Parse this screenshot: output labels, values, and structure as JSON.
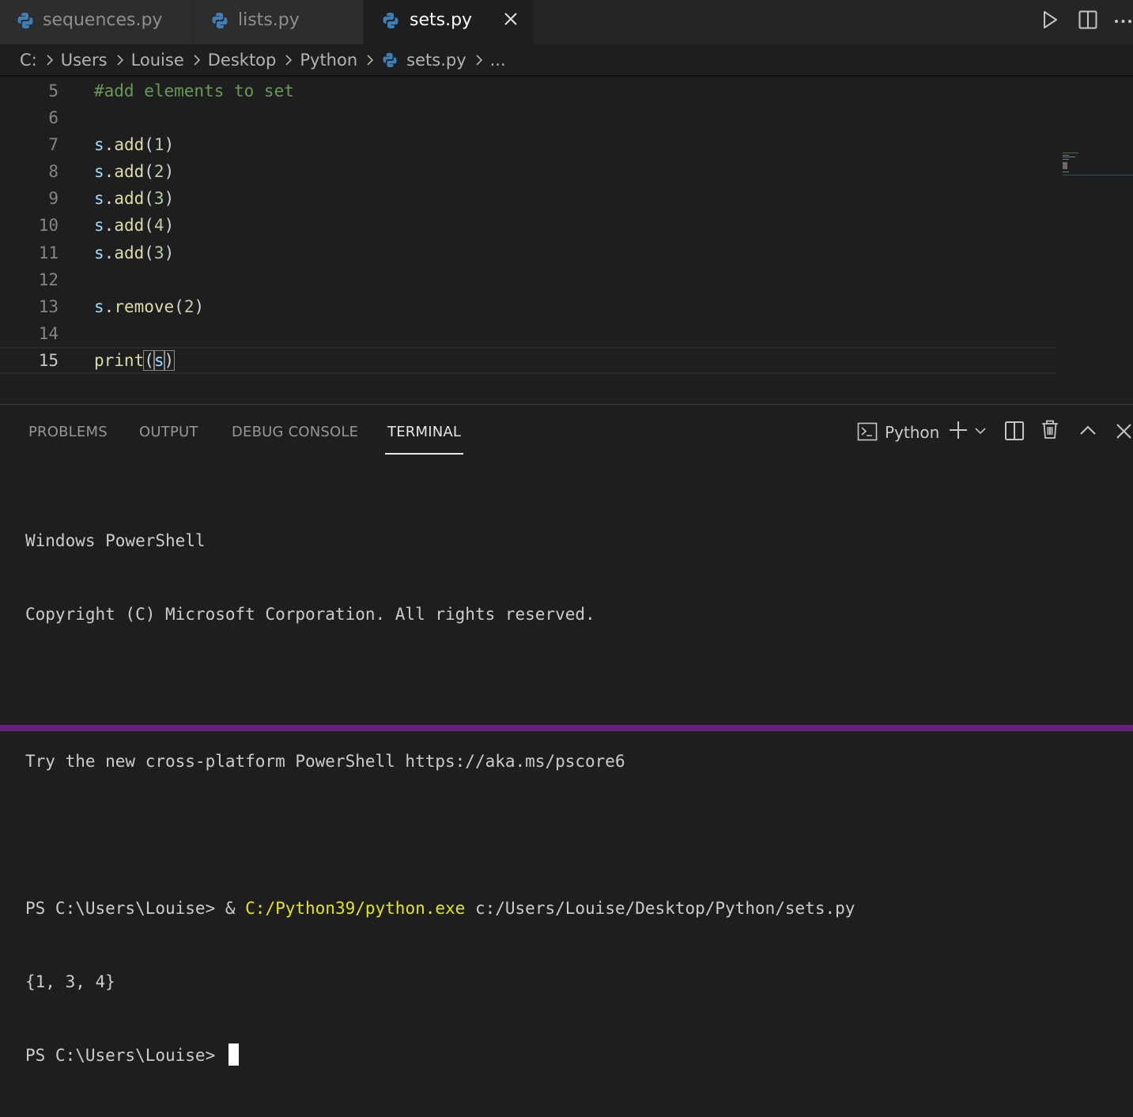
{
  "tabs": [
    {
      "label": "sequences.py",
      "active": false
    },
    {
      "label": "lists.py",
      "active": false
    },
    {
      "label": "sets.py",
      "active": true
    }
  ],
  "title_actions": [
    "run-icon",
    "split-editor-icon",
    "more-actions-icon"
  ],
  "breadcrumb": {
    "parts": [
      "C:",
      "Users",
      "Louise",
      "Desktop",
      "Python",
      "sets.py",
      "..."
    ]
  },
  "editor": {
    "current_line": 15,
    "lines": [
      {
        "n": "5",
        "text": "#add elements to set"
      },
      {
        "n": "6",
        "text": ""
      },
      {
        "n": "7",
        "text": "s.add(1)"
      },
      {
        "n": "8",
        "text": "s.add(2)"
      },
      {
        "n": "9",
        "text": "s.add(3)"
      },
      {
        "n": "10",
        "text": "s.add(4)"
      },
      {
        "n": "11",
        "text": "s.add(3)"
      },
      {
        "n": "12",
        "text": ""
      },
      {
        "n": "13",
        "text": "s.remove(2)"
      },
      {
        "n": "14",
        "text": ""
      },
      {
        "n": "15",
        "text": "print(s)"
      }
    ]
  },
  "panel": {
    "tabs": [
      {
        "label": "PROBLEMS",
        "active": false
      },
      {
        "label": "OUTPUT",
        "active": false
      },
      {
        "label": "DEBUG CONSOLE",
        "active": false
      },
      {
        "label": "TERMINAL",
        "active": true
      }
    ],
    "shell_label": "Python",
    "actions": [
      "terminal-shell-icon",
      "new-terminal-plus-icon",
      "chevron-down-icon",
      "split-terminal-icon",
      "trash-icon",
      "maximize-panel-chevron-up-icon",
      "close-panel-icon"
    ]
  },
  "terminal": {
    "line1": "Windows PowerShell",
    "line2": "Copyright (C) Microsoft Corporation. All rights reserved.",
    "line3": "Try the new cross-platform PowerShell https://aka.ms/pscore6",
    "prompt1": "PS C:\\Users\\Louise> & ",
    "exe": "C:/Python39/python.exe",
    "script_path": " c:/Users/Louise/Desktop/Python/sets.py",
    "output": "{1, 3, 4}",
    "prompt2": "PS C:\\Users\\Louise> "
  },
  "colors": {
    "accent_statusbar": "#68217a",
    "editor_bg": "#1e1e1e",
    "comment": "#6a9955",
    "variable": "#9cdcfe",
    "function": "#dcdcaa",
    "number": "#b5cea8",
    "terminal_exe": "#e5e510"
  }
}
